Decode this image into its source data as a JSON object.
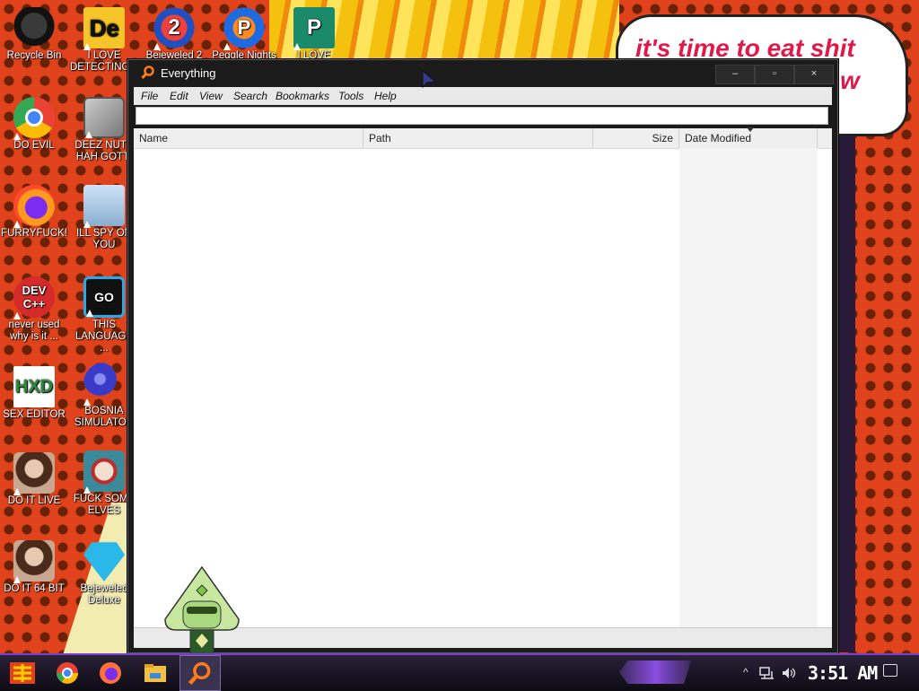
{
  "wallpaper": {
    "speech_line1": "it's time to eat shit",
    "speech_line2": "w"
  },
  "desktop_icons": [
    {
      "label": "Recycle Bin",
      "icon": "recycle-bin-icon",
      "color": "#2a2a2a"
    },
    {
      "label": "I LOVE DETECTING...",
      "icon": "detective-game-icon",
      "color": "#f5c52a"
    },
    {
      "label": "Bejeweled 2",
      "icon": "bejeweled2-icon",
      "color": "#c02020"
    },
    {
      "label": "Peggle Nights",
      "icon": "peggle-icon",
      "color": "#1e6ae0"
    },
    {
      "label": "I LOVE",
      "icon": "publisher-icon",
      "color": "#1b8a6b"
    },
    {
      "label": "DO EVIL",
      "icon": "chrome-icon",
      "color": "#4285f4"
    },
    {
      "label": "DEEZ NUTS HAH GOTTI",
      "icon": "windows-stack-icon",
      "color": "#9a9a9a"
    },
    {
      "label": "FURRYFUCK!",
      "icon": "firefox-icon",
      "color": "#ff7139"
    },
    {
      "label": "ILL SPY ON YOU",
      "icon": "network-icon",
      "color": "#9ab8d8"
    },
    {
      "label": "never used why is it ...",
      "icon": "devcpp-icon",
      "color": "#d42a2a"
    },
    {
      "label": "THIS LANGUAGE ...",
      "icon": "goland-icon",
      "color": "#1a1a2e"
    },
    {
      "label": "SEX EDITOR",
      "icon": "hxd-icon",
      "color": "#ffffff"
    },
    {
      "label": "BOSNIA SIMULATOR",
      "icon": "mine-icon",
      "color": "#3a3ac8"
    },
    {
      "label": "DO IT LIVE",
      "icon": "portrait-icon",
      "color": "#6a4a3a"
    },
    {
      "label": "FUCK SOME ELVES",
      "icon": "elf-icon",
      "color": "#3a8a9a"
    },
    {
      "label": "DO IT 64 BIT",
      "icon": "portrait64-icon",
      "color": "#6a4a3a"
    },
    {
      "label": "Bejeweled Deluxe",
      "icon": "diamond-icon",
      "color": "#2ab8e8"
    }
  ],
  "window": {
    "title": "Everything",
    "minimize": "–",
    "maximize": "▫",
    "close": "×",
    "menu": [
      "File",
      "Edit",
      "View",
      "Search",
      "Bookmarks",
      "Tools",
      "Help"
    ],
    "search_value": "",
    "columns": [
      "Name",
      "Path",
      "Size",
      "Date Modified"
    ],
    "sorted_column": "Date Modified",
    "status_text": ""
  },
  "taskbar": {
    "clock": "3:51 AM",
    "apps": [
      "start-icon",
      "chrome-icon",
      "firefox-icon",
      "file-explorer-icon",
      "everything-search-icon"
    ],
    "tray_chevron": "^"
  },
  "colors": {
    "accent_purple": "#7a3fd0",
    "window_dark": "#1b1b1b",
    "wallpaper_orange": "#e0431b"
  }
}
